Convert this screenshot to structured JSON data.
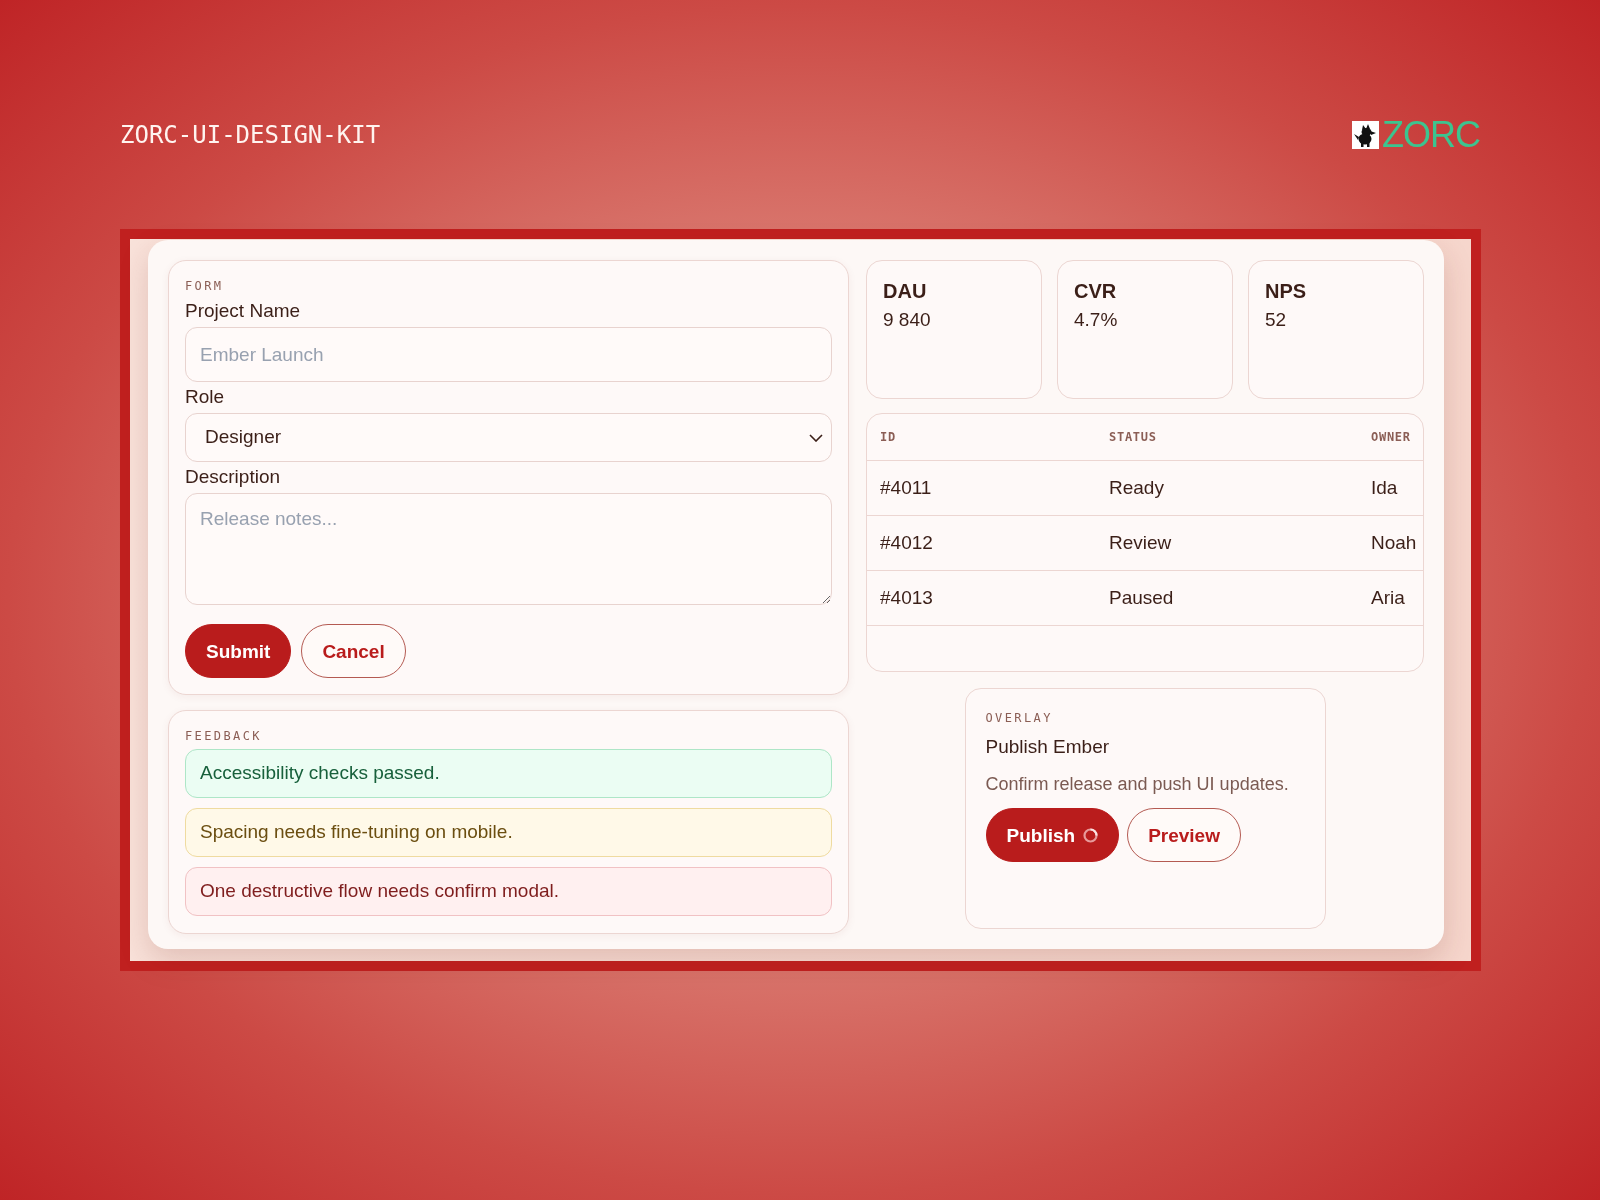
{
  "header": {
    "title": "ZORC-UI-DESIGN-KIT",
    "brand": "ZORC"
  },
  "form": {
    "section_label": "FORM",
    "fields": [
      {
        "kind": "text",
        "label": "Project Name",
        "placeholder": "Ember Launch"
      },
      {
        "kind": "select",
        "label": "Role",
        "value": "Designer"
      },
      {
        "kind": "textarea",
        "label": "Description",
        "placeholder": "Release notes..."
      }
    ],
    "buttons": [
      {
        "kind": "primary",
        "label": "Submit"
      },
      {
        "kind": "secondary",
        "label": "Cancel"
      }
    ]
  },
  "feedback": {
    "section_label": "FEEDBACK",
    "alerts": [
      {
        "kind": "success",
        "text": "Accessibility checks passed."
      },
      {
        "kind": "warning",
        "text": "Spacing needs fine-tuning on mobile."
      },
      {
        "kind": "error",
        "text": "One destructive flow needs confirm modal."
      }
    ]
  },
  "metrics": [
    {
      "label": "DAU",
      "value": "9 840"
    },
    {
      "label": "CVR",
      "value": "4.7%"
    },
    {
      "label": "NPS",
      "value": "52"
    }
  ],
  "table": {
    "columns": [
      "ID",
      "STATUS",
      "OWNER"
    ],
    "rows": [
      [
        "#4011",
        "Ready",
        "Ida"
      ],
      [
        "#4012",
        "Review",
        "Noah"
      ],
      [
        "#4013",
        "Paused",
        "Aria"
      ]
    ]
  },
  "overlay": {
    "section_label": "OVERLAY",
    "title": "Publish Ember",
    "description": "Confirm release and push UI updates.",
    "buttons": [
      {
        "kind": "primary",
        "label": "Publish",
        "loading": true
      },
      {
        "kind": "secondary",
        "label": "Preview",
        "loading": false
      }
    ]
  }
}
